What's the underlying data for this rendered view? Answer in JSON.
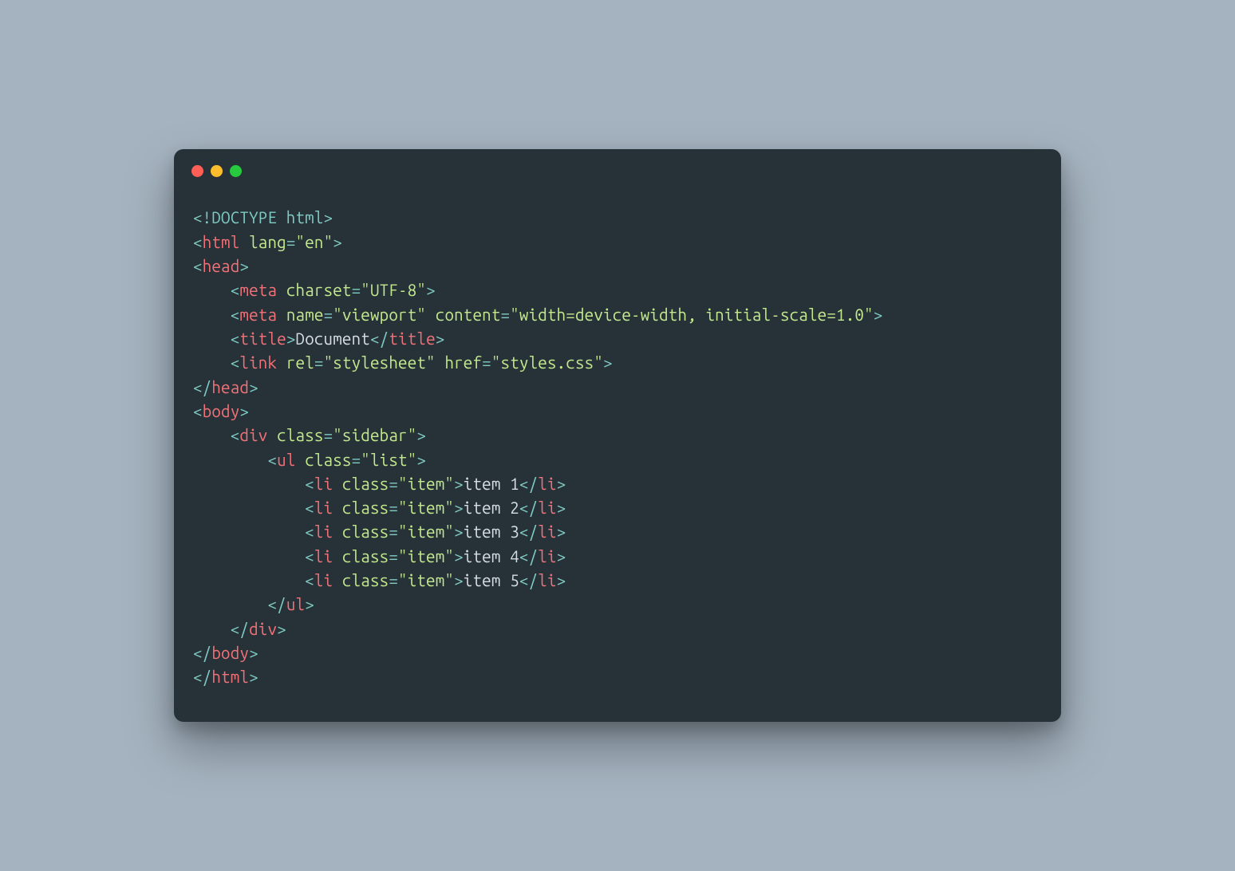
{
  "code": {
    "doctype": "<!DOCTYPE html>",
    "html_open": {
      "tag": "html",
      "attr": "lang",
      "val": "\"en\""
    },
    "head_open": "head",
    "meta1": {
      "tag": "meta",
      "attr": "charset",
      "val": "\"UTF-8\""
    },
    "meta2": {
      "tag": "meta",
      "a1": "name",
      "v1": "\"viewport\"",
      "a2": "content",
      "v2": "\"width=device-width, initial-scale=1.0\""
    },
    "title": {
      "tag": "title",
      "text": "Document"
    },
    "link": {
      "tag": "link",
      "a1": "rel",
      "v1": "\"stylesheet\"",
      "a2": "href",
      "v2": "\"styles.css\""
    },
    "head_close": "head",
    "body_open": "body",
    "div_open": {
      "tag": "div",
      "attr": "class",
      "val": "\"sidebar\""
    },
    "ul_open": {
      "tag": "ul",
      "attr": "class",
      "val": "\"list\""
    },
    "li": {
      "tag": "li",
      "attr": "class",
      "val": "\"item\""
    },
    "items": [
      "item 1",
      "item 2",
      "item 3",
      "item 4",
      "item 5"
    ],
    "ul_close": "ul",
    "div_close": "div",
    "body_close": "body",
    "html_close": "html"
  }
}
